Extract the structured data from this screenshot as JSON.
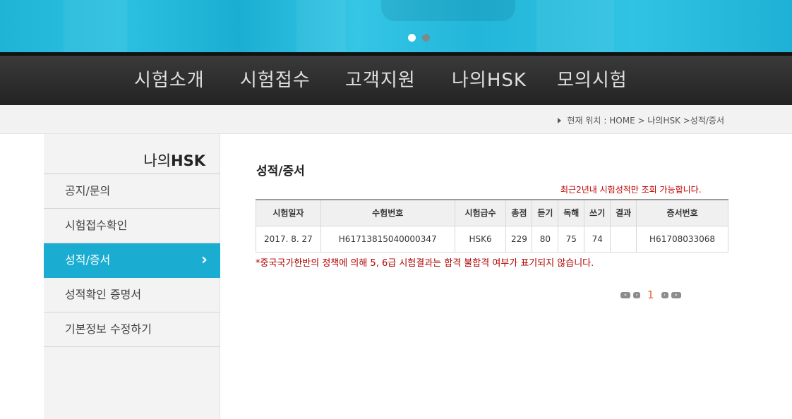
{
  "banner": {
    "slides_total": 2,
    "active_slide": 1
  },
  "nav": {
    "items": [
      "시험소개",
      "시험접수",
      "고객지원",
      "나의HSK",
      "모의시험"
    ]
  },
  "breadcrumb": {
    "prefix": "현재 위치",
    "path": ": HOME > 나의HSK >성적/증서"
  },
  "sidebar": {
    "title_prefix": "나의",
    "title_bold": "HSK",
    "items": [
      {
        "label": "공지/문의",
        "active": false
      },
      {
        "label": "시험접수확인",
        "active": false
      },
      {
        "label": "성적/증서",
        "active": true
      },
      {
        "label": "성적확인 증명서",
        "active": false
      },
      {
        "label": "기본정보 수정하기",
        "active": false
      }
    ],
    "active_chevron": "›"
  },
  "main": {
    "title": "성적/증서",
    "notice": "최근2년내 시험성적만 조회 가능합니다.",
    "table": {
      "headers": [
        "시험일자",
        "수험번호",
        "시험급수",
        "총점",
        "듣기",
        "독해",
        "쓰기",
        "결과",
        "증서번호"
      ],
      "rows": [
        [
          "2017. 8. 27",
          "H61713815040000347",
          "HSK6",
          "229",
          "80",
          "75",
          "74",
          "",
          "H61708033068"
        ]
      ]
    },
    "footnote": "*중국국가한반의 정책에 의해 5, 6급 시험결과는 합격 불합격 여부가 표기되지 않습니다.",
    "pager": {
      "first": "«",
      "prev": "‹",
      "current": "1",
      "next": "›",
      "last": "»"
    }
  },
  "colors": {
    "accent": "#1badd1",
    "notice_red": "#c00000",
    "page_orange": "#e06b1f",
    "nav_bg": "#2b2b2b"
  }
}
